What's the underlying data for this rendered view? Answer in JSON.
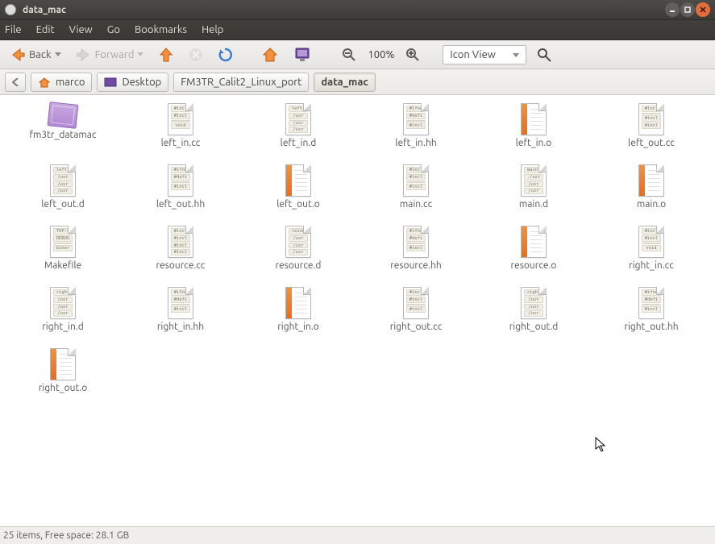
{
  "window": {
    "title": "data_mac"
  },
  "menu": {
    "items": [
      "File",
      "Edit",
      "View",
      "Go",
      "Bookmarks",
      "Help"
    ]
  },
  "toolbar": {
    "back_label": "Back",
    "forward_label": "Forward",
    "zoom_text": "100%",
    "view_mode": "Icon View"
  },
  "path": {
    "segments": [
      "marco",
      "Desktop",
      "FM3TR_Calit2_Linux_port",
      "data_mac"
    ],
    "current_index": 3
  },
  "files": [
    {
      "name": "fm3tr_datamac",
      "icon": "ruler"
    },
    {
      "name": "left_in.cc",
      "icon": "code",
      "lines": [
        "#incl",
        "#incl",
        " ",
        "void"
      ]
    },
    {
      "name": "left_in.d",
      "icon": "code",
      "lines": [
        "left_",
        "/usr",
        "/usr",
        "/usr"
      ]
    },
    {
      "name": "left_in.hh",
      "icon": "code",
      "lines": [
        "#ifnd",
        "#defi",
        " ",
        "#incl"
      ]
    },
    {
      "name": "left_in.o",
      "icon": "obj"
    },
    {
      "name": "left_out.cc",
      "icon": "code",
      "lines": [
        "#incl",
        " ",
        "#incl",
        "#incl"
      ]
    },
    {
      "name": "left_out.d",
      "icon": "code",
      "lines": [
        "left_",
        "/usr",
        "/usr",
        "/usr"
      ]
    },
    {
      "name": "left_out.hh",
      "icon": "code",
      "lines": [
        "#ifnd",
        "#defi",
        " ",
        "#incl"
      ]
    },
    {
      "name": "left_out.o",
      "icon": "obj"
    },
    {
      "name": "main.cc",
      "icon": "code",
      "lines": [
        "#incl",
        "#incl",
        " ",
        "#incl"
      ]
    },
    {
      "name": "main.d",
      "icon": "code",
      "lines": [
        "main.",
        "./usr",
        "/usr",
        "/usr"
      ]
    },
    {
      "name": "main.o",
      "icon": "obj"
    },
    {
      "name": "Makefile",
      "icon": "code",
      "lines": [
        "TOP:=",
        "DEBUG",
        " ",
        "binar"
      ]
    },
    {
      "name": "resource.cc",
      "icon": "code",
      "lines": [
        "#incl",
        "#incl",
        "#incl",
        "#incl"
      ]
    },
    {
      "name": "resource.d",
      "icon": "code",
      "lines": [
        "resou",
        "/usr",
        "/usr",
        "/usr"
      ]
    },
    {
      "name": "resource.hh",
      "icon": "code",
      "lines": [
        "#ifnd",
        "#defi",
        " ",
        "#incl"
      ]
    },
    {
      "name": "resource.o",
      "icon": "obj"
    },
    {
      "name": "right_in.cc",
      "icon": "code",
      "lines": [
        "#incl",
        "#incl",
        " ",
        "void"
      ]
    },
    {
      "name": "right_in.d",
      "icon": "code",
      "lines": [
        "right",
        "/usr",
        "/usr",
        "/usr"
      ]
    },
    {
      "name": "right_in.hh",
      "icon": "code",
      "lines": [
        "#ifnd",
        "#defi",
        " ",
        "#incl"
      ]
    },
    {
      "name": "right_in.o",
      "icon": "obj"
    },
    {
      "name": "right_out.cc",
      "icon": "code",
      "lines": [
        "#incl",
        "#incl",
        " ",
        "#incl"
      ]
    },
    {
      "name": "right_out.d",
      "icon": "code",
      "lines": [
        "right",
        "/usr",
        "/usr",
        "/usr"
      ]
    },
    {
      "name": "right_out.hh",
      "icon": "code",
      "lines": [
        "#ifnd",
        "#defi",
        " ",
        "#incl"
      ]
    },
    {
      "name": "right_out.o",
      "icon": "obj"
    }
  ],
  "status": {
    "text": "25 items, Free space: 28.1 GB"
  }
}
